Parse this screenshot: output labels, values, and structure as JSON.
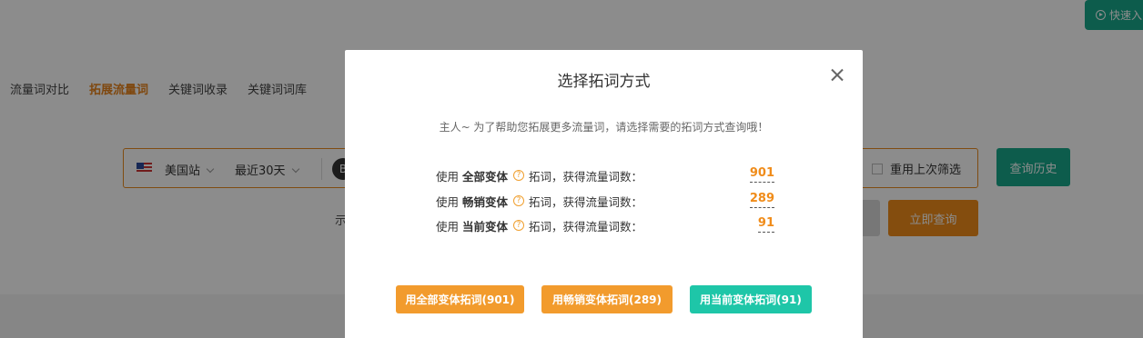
{
  "header": {
    "quick_entry_label": "快速入"
  },
  "tabs": [
    {
      "label": "流量词对比"
    },
    {
      "label": "拓展流量词"
    },
    {
      "label": "关键词收录"
    },
    {
      "label": "关键词词库"
    }
  ],
  "search": {
    "site_label": "美国站",
    "range_label": "最近30天",
    "circle_label": "B",
    "reuse_filter_label": "重用上次筛选",
    "history_button": "查询历史",
    "query_button": "立即查询",
    "hint_fragment": "示"
  },
  "modal": {
    "title": "选择拓词方式",
    "intro": "主人~ 为了帮助您拓展更多流量词，请选择需要的拓词方式查询哦！",
    "options": [
      {
        "prefix": "使用",
        "variant": "全部变体",
        "suffix": "拓词，获得流量词数：",
        "count": "901"
      },
      {
        "prefix": "使用",
        "variant": "畅销变体",
        "suffix": "拓词，获得流量词数：",
        "count": "289"
      },
      {
        "prefix": "使用",
        "variant": "当前变体",
        "suffix": "拓词，获得流量词数：",
        "count": "91"
      }
    ],
    "buttons": {
      "all": "用全部变体拓词(901)",
      "bestseller": "用畅销变体拓词(289)",
      "current": "用当前变体拓词(91)"
    }
  },
  "colors": {
    "accent_orange": "#f08c1a",
    "accent_teal": "#18a88a",
    "button_teal": "#1ec6a8"
  }
}
